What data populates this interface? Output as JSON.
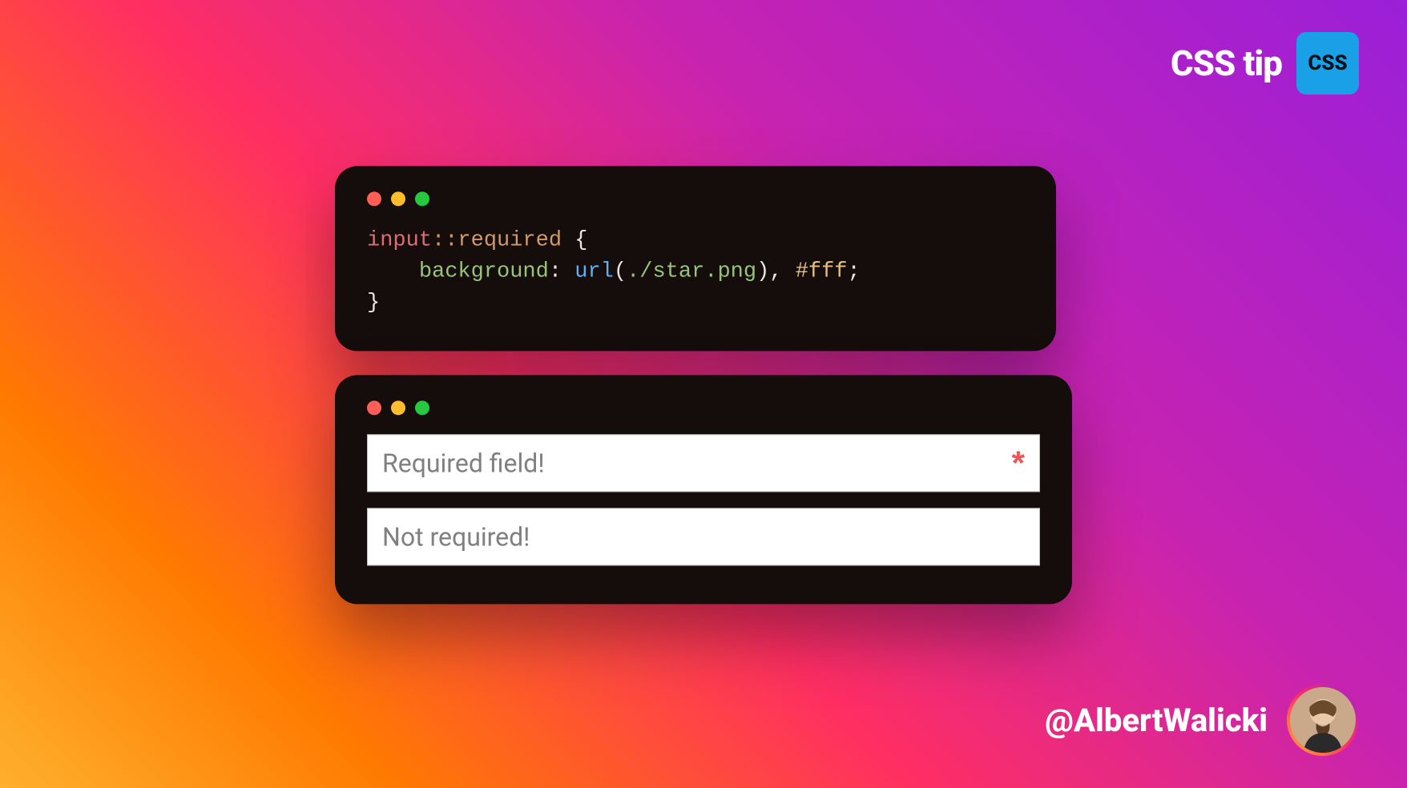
{
  "brand": {
    "text": "CSS tip",
    "badge": "CSS"
  },
  "author": {
    "handle": "@AlbertWalicki"
  },
  "traffic_lights": {
    "red": "#ff5f56",
    "yellow": "#ffbd2e",
    "green": "#27c93f"
  },
  "code": {
    "selector_tag": "input",
    "pseudo_prefix": "::",
    "pseudo_name": "required",
    "open": " {",
    "property": "background",
    "colon": ":",
    "func": "url",
    "paren_open": "(",
    "url_value": "./star.png",
    "paren_close": ")",
    "comma": ", ",
    "hex": "#fff",
    "semicolon": ";",
    "close": "}"
  },
  "example": {
    "required_placeholder": "Required field!",
    "optional_placeholder": "Not required!",
    "star_glyph": "*"
  }
}
